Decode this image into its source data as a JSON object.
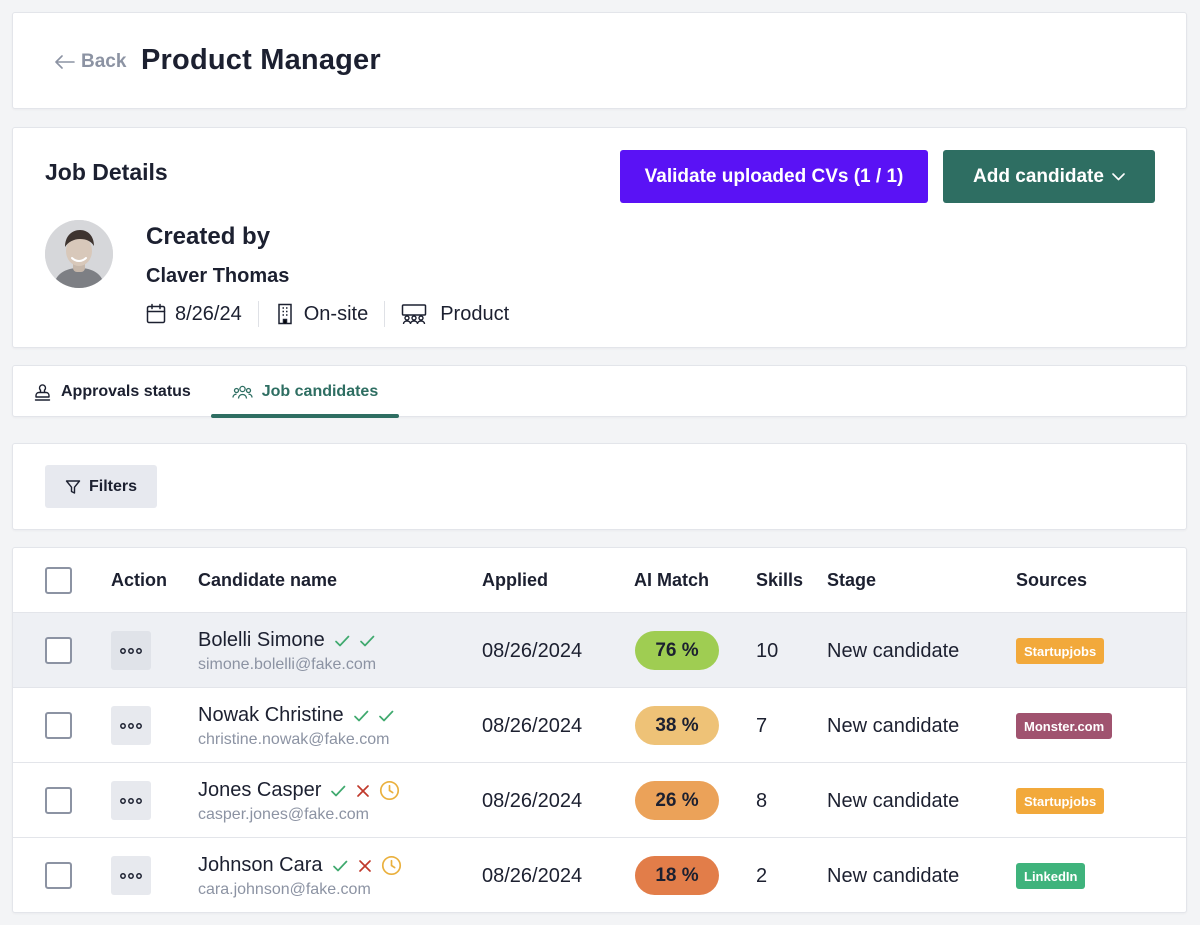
{
  "header": {
    "back_label": "Back",
    "title": "Product Manager"
  },
  "job_details": {
    "section_title": "Job Details",
    "validate_button": "Validate uploaded CVs (1 / 1)",
    "add_candidate_button": "Add candidate",
    "created_by_label": "Created by",
    "creator_name": "Claver Thomas",
    "date": "8/26/24",
    "work_mode": "On-site",
    "department": "Product",
    "colors": {
      "validate": "#5a12f5",
      "add": "#2e6e62"
    }
  },
  "tabs": [
    {
      "label": "Approvals status",
      "icon": "stamp-icon",
      "active": false
    },
    {
      "label": "Job candidates",
      "icon": "users-icon",
      "active": true
    }
  ],
  "filters": {
    "label": "Filters",
    "icon": "filter-icon"
  },
  "table": {
    "columns": {
      "action": "Action",
      "name": "Candidate name",
      "applied": "Applied",
      "ai_match": "AI Match",
      "skills": "Skills",
      "stage": "Stage",
      "sources": "Sources"
    },
    "rows": [
      {
        "name": "Bolelli Simone",
        "email": "simone.bolelli@fake.com",
        "status_icons": [
          "check-icon",
          "check-icon"
        ],
        "applied": "08/26/2024",
        "ai_match": "76 %",
        "match_color": "#9fcd52",
        "skills": "10",
        "stage": "New candidate",
        "source": "Startupjobs",
        "source_color": "#f2a93b"
      },
      {
        "name": "Nowak Christine",
        "email": "christine.nowak@fake.com",
        "status_icons": [
          "check-icon",
          "check-icon"
        ],
        "applied": "08/26/2024",
        "ai_match": "38 %",
        "match_color": "#eec277",
        "skills": "7",
        "stage": "New candidate",
        "source": "Monster.com",
        "source_color": "#a0536f"
      },
      {
        "name": "Jones Casper",
        "email": "casper.jones@fake.com",
        "status_icons": [
          "check-icon",
          "cross-icon",
          "clock-icon"
        ],
        "applied": "08/26/2024",
        "ai_match": "26 %",
        "match_color": "#eba259",
        "skills": "8",
        "stage": "New candidate",
        "source": "Startupjobs",
        "source_color": "#f2a93b"
      },
      {
        "name": "Johnson Cara",
        "email": "cara.johnson@fake.com",
        "status_icons": [
          "check-icon",
          "cross-icon",
          "clock-icon"
        ],
        "applied": "08/26/2024",
        "ai_match": "18 %",
        "match_color": "#e27d49",
        "skills": "2",
        "stage": "New candidate",
        "source": "LinkedIn",
        "source_color": "#3fb37c"
      }
    ]
  }
}
